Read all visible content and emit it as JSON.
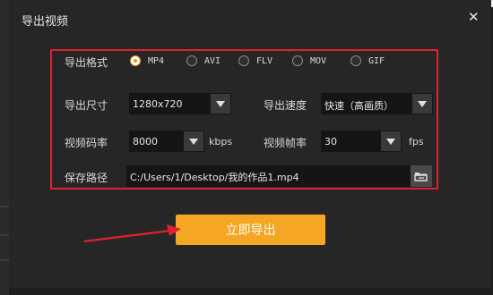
{
  "dialog": {
    "title": "导出视频",
    "close_glyph": "✕"
  },
  "format": {
    "label": "导出格式",
    "options": [
      "MP4",
      "AVI",
      "FLV",
      "MOV",
      "GIF"
    ],
    "selected": "MP4"
  },
  "size": {
    "label": "导出尺寸",
    "value": "1280x720"
  },
  "speed": {
    "label": "导出速度",
    "value": "快速（高画质）"
  },
  "bitrate": {
    "label": "视频码率",
    "value": "8000",
    "unit": "kbps"
  },
  "framerate": {
    "label": "视频帧率",
    "value": "30",
    "unit": "fps"
  },
  "save_path": {
    "label": "保存路径",
    "value": "C:/Users/1/Desktop/我的作品1.mp4",
    "browse_icon": "folder-icon"
  },
  "export_button": {
    "label": "立即导出"
  },
  "colors": {
    "accent": "#f5a623",
    "highlight_frame": "#e0222d",
    "radio_selected": "#f08c1a"
  }
}
